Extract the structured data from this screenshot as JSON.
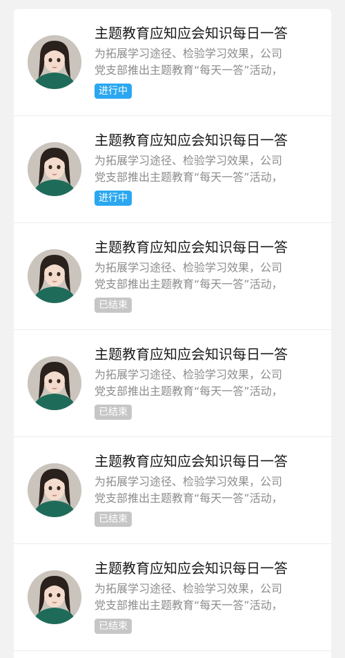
{
  "colors": {
    "active_badge": "#2aa7f0",
    "ended_badge": "#c6c6c6",
    "title_text": "#1a1a1a",
    "desc_text": "#8c8c8c"
  },
  "items": [
    {
      "avatar_icon": "avatar-portrait-icon",
      "title": "主题教育应知应会知识每日一答",
      "desc_line1": "为拓展学习途径、检验学习效果，公司",
      "desc_line2": "党支部推出主题教育“每天一答”活动，",
      "status": "进行中",
      "status_type": "active"
    },
    {
      "avatar_icon": "avatar-portrait-icon",
      "title": "主题教育应知应会知识每日一答",
      "desc_line1": "为拓展学习途径、检验学习效果，公司",
      "desc_line2": "党支部推出主题教育“每天一答”活动，",
      "status": "进行中",
      "status_type": "active"
    },
    {
      "avatar_icon": "avatar-portrait-icon",
      "title": "主题教育应知应会知识每日一答",
      "desc_line1": "为拓展学习途径、检验学习效果，公司",
      "desc_line2": "党支部推出主题教育“每天一答”活动，",
      "status": "已结束",
      "status_type": "ended"
    },
    {
      "avatar_icon": "avatar-portrait-icon",
      "title": "主题教育应知应会知识每日一答",
      "desc_line1": "为拓展学习途径、检验学习效果，公司",
      "desc_line2": "党支部推出主题教育“每天一答”活动，",
      "status": "已结束",
      "status_type": "ended"
    },
    {
      "avatar_icon": "avatar-portrait-icon",
      "title": "主题教育应知应会知识每日一答",
      "desc_line1": "为拓展学习途径、检验学习效果，公司",
      "desc_line2": "党支部推出主题教育“每天一答”活动，",
      "status": "已结束",
      "status_type": "ended"
    },
    {
      "avatar_icon": "avatar-portrait-icon",
      "title": "主题教育应知应会知识每日一答",
      "desc_line1": "为拓展学习途径、检验学习效果，公司",
      "desc_line2": "党支部推出主题教育“每天一答”活动，",
      "status": "已结束",
      "status_type": "ended"
    }
  ]
}
